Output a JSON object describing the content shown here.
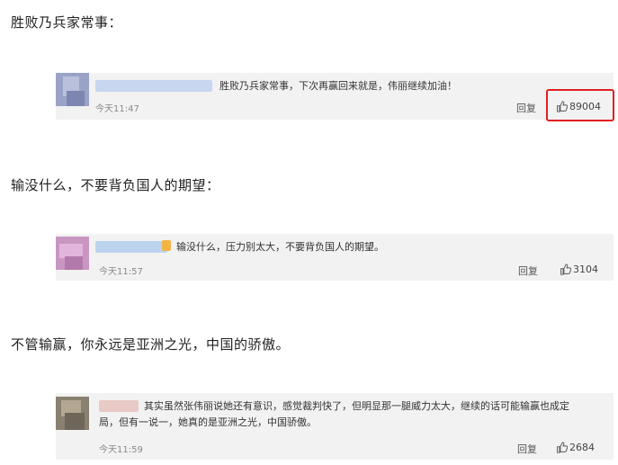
{
  "sections": [
    {
      "heading": "胜败乃兵家常事：",
      "comment": {
        "text_lines": [
          "胜败乃兵家常事，下次再赢回来就是，伟丽继续加油！"
        ],
        "time": "今天11:47",
        "reply_label": "回复",
        "likes": "89004",
        "likes_highlighted": true,
        "avatar_colors": [
          "#9aa3c6",
          "#b9c0dc",
          "#7c86b0"
        ],
        "name_color": "#c9d6ef"
      }
    },
    {
      "heading": "输没什么，不要背负国人的期望：",
      "comment": {
        "text_lines": [
          "输没什么，压力别太大，不要背负国人的期望。"
        ],
        "time": "今天11:57",
        "reply_label": "回复",
        "likes": "3104",
        "likes_highlighted": false,
        "avatar_colors": [
          "#c996c2",
          "#e2b6dc",
          "#b27aaa"
        ],
        "name_color": "#bcd3ee"
      }
    },
    {
      "heading": "不管输赢，你永远是亚洲之光，中国的骄傲。",
      "comment": {
        "text_lines": [
          "其实虽然张伟丽说她还有意识，感觉裁判快了，但明显那一腿威力太大，继续的话可能输赢也成定",
          "局，但有一说一，她真的是亚洲之光，中国骄傲。"
        ],
        "time": "今天11:59",
        "reply_label": "回复",
        "likes": "2684",
        "likes_highlighted": false,
        "avatar_colors": [
          "#8a8070",
          "#b3a792",
          "#6e6658"
        ],
        "name_color": "#e8c9c6"
      }
    }
  ],
  "icons": {
    "like": "thumbs-up-icon"
  },
  "accent": {
    "highlight_border": "#e02020"
  }
}
